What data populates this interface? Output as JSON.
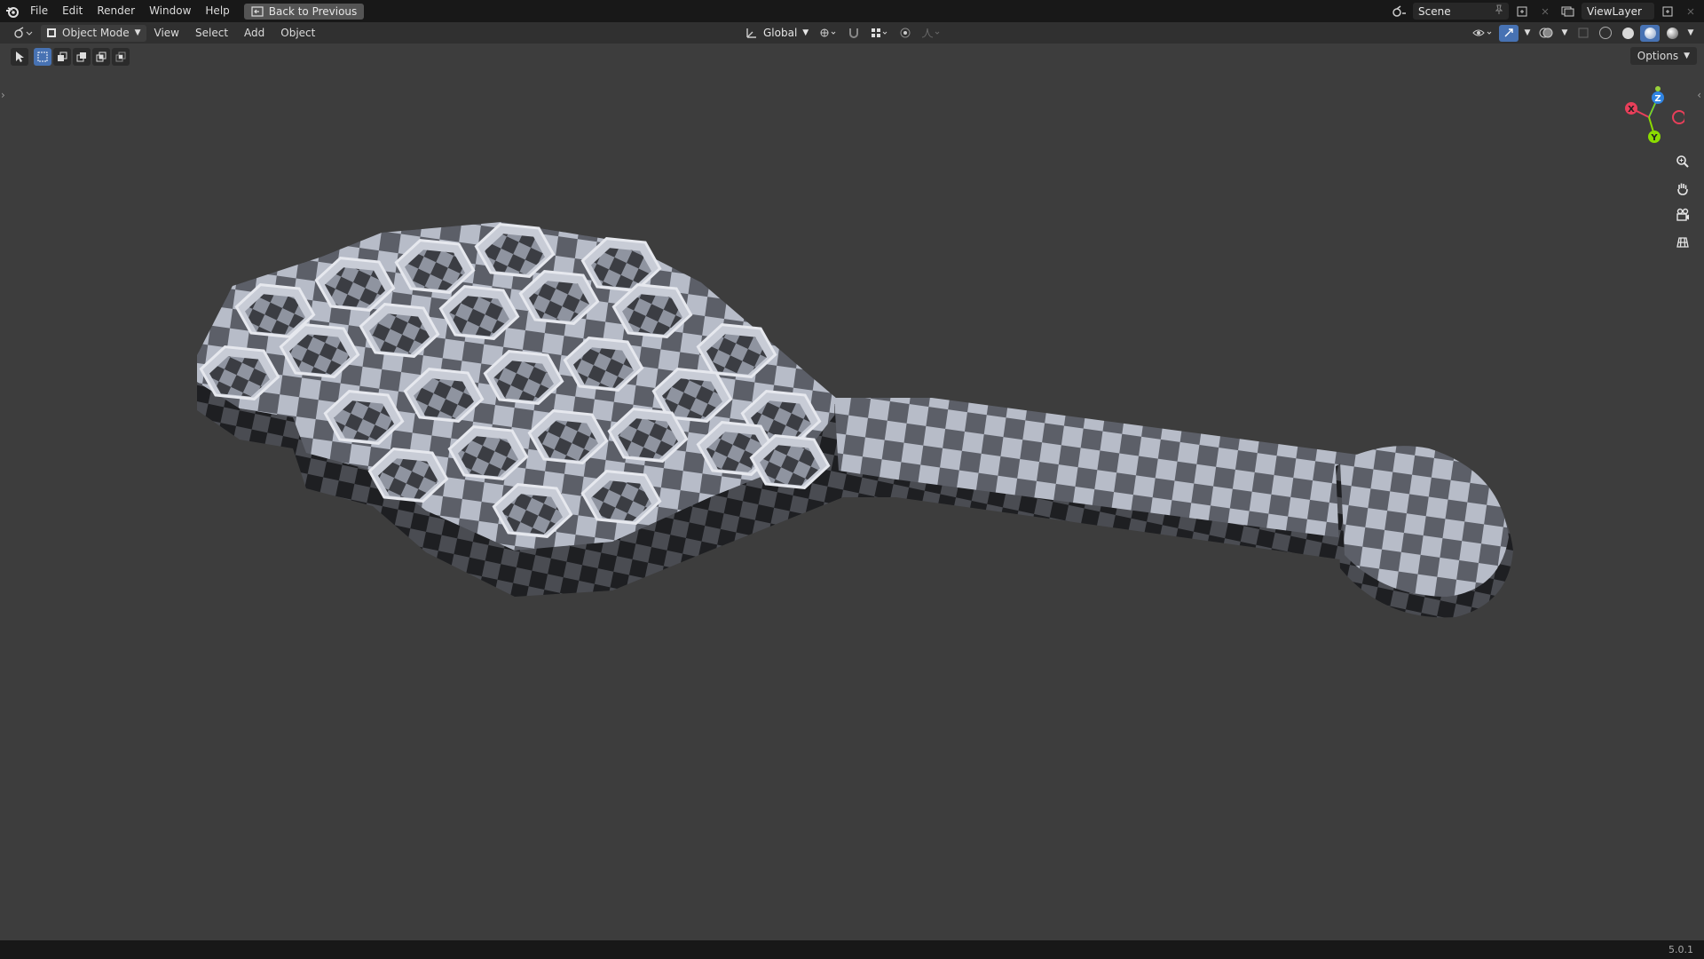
{
  "topbar": {
    "menus": [
      "File",
      "Edit",
      "Render",
      "Window",
      "Help"
    ],
    "back_label": "Back to Previous",
    "scene_label": "Scene",
    "viewlayer_label": "ViewLayer"
  },
  "header": {
    "mode_label": "Object Mode",
    "menus": [
      "View",
      "Select",
      "Add",
      "Object"
    ],
    "orientation_label": "Global"
  },
  "options_label": "Options",
  "gizmo": {
    "x_label": "X",
    "y_label": "Y",
    "z_label": "Z"
  },
  "colors": {
    "accent": "#4772b3",
    "x_axis": "#e83f5a",
    "y_axis": "#8bdc00",
    "z_axis": "#2f84e3"
  },
  "icons": [
    "blender-logo",
    "editor-type-icon",
    "cursor-icon",
    "zoom-icon",
    "hand-icon",
    "camera-icon",
    "grid-icon"
  ],
  "footer": {
    "version": "5.0.1"
  }
}
